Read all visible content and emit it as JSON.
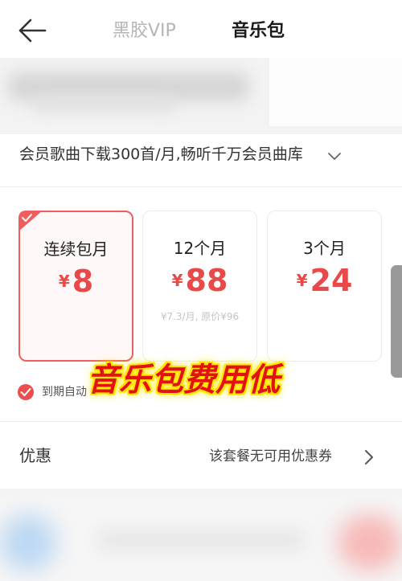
{
  "header": {
    "back_icon": "back-arrow-icon",
    "tabs": [
      {
        "label": "黑胶VIP",
        "active": false
      },
      {
        "label": "音乐包",
        "active": true
      }
    ]
  },
  "description": {
    "text": "会员歌曲下载300首/月,畅听千万会员曲库",
    "icon": "chevron-down-icon"
  },
  "plans": [
    {
      "name": "连续包月",
      "currency": "¥",
      "price": "8",
      "sub": "",
      "selected": true
    },
    {
      "name": "12个月",
      "currency": "¥",
      "price": "88",
      "sub": "¥7.3/月, 原价¥96",
      "selected": false
    },
    {
      "name": "3个月",
      "currency": "¥",
      "price": "24",
      "sub": "",
      "selected": false
    }
  ],
  "auto_renew": {
    "checked": true,
    "visible_text": "到期自动"
  },
  "overlay": {
    "text": "音乐包费用低"
  },
  "discount": {
    "label": "优惠",
    "value": "该套餐无可用优惠券",
    "icon": "chevron-right-icon"
  },
  "colors": {
    "accent": "#e84a4a",
    "selected_border": "#ef5d5d",
    "overlay_text": "#e31212",
    "overlay_glow": "#ffe600"
  }
}
